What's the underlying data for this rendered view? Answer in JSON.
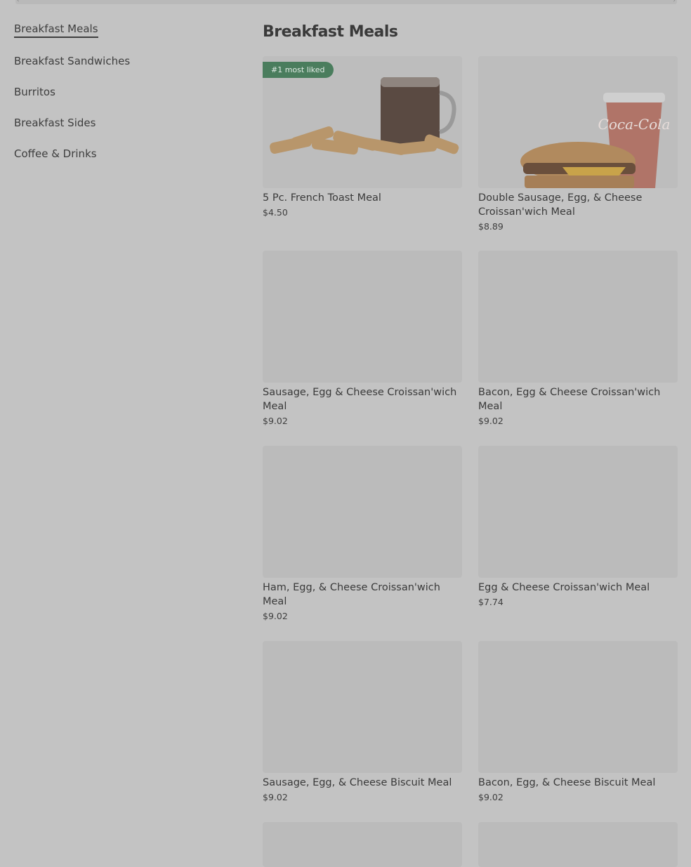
{
  "sidebar": {
    "items": [
      {
        "label": "Breakfast Meals",
        "active": true
      },
      {
        "label": "Breakfast Sandwiches",
        "active": false
      },
      {
        "label": "Burritos",
        "active": false
      },
      {
        "label": "Breakfast Sides",
        "active": false
      },
      {
        "label": "Coffee & Drinks",
        "active": false
      }
    ]
  },
  "main": {
    "title": "Breakfast Meals",
    "products": [
      {
        "name": "5 Pc. French Toast Meal",
        "price": "$4.50",
        "badge": "#1 most liked",
        "image": "french-toast-coffee"
      },
      {
        "name": "Double Sausage, Egg, & Cheese Croissan'wich Meal",
        "price": "$8.89",
        "image": "croissanwich-cola"
      },
      {
        "name": "Sausage, Egg & Cheese Croissan'wich Meal",
        "price": "$9.02"
      },
      {
        "name": "Bacon, Egg & Cheese Croissan'wich Meal",
        "price": "$9.02"
      },
      {
        "name": "Ham, Egg, & Cheese Croissan'wich Meal",
        "price": "$9.02"
      },
      {
        "name": "Egg & Cheese Croissan'wich Meal",
        "price": "$7.74"
      },
      {
        "name": "Sausage, Egg, & Cheese Biscuit Meal",
        "price": "$9.02"
      },
      {
        "name": "Bacon, Egg, & Cheese Biscuit Meal",
        "price": "$9.02"
      },
      {
        "name": "",
        "price": ""
      },
      {
        "name": "",
        "price": ""
      }
    ]
  },
  "colors": {
    "page_background": "#c3c3c3",
    "placeholder": "#bbbbbb",
    "badge": "#4a7d5d"
  }
}
